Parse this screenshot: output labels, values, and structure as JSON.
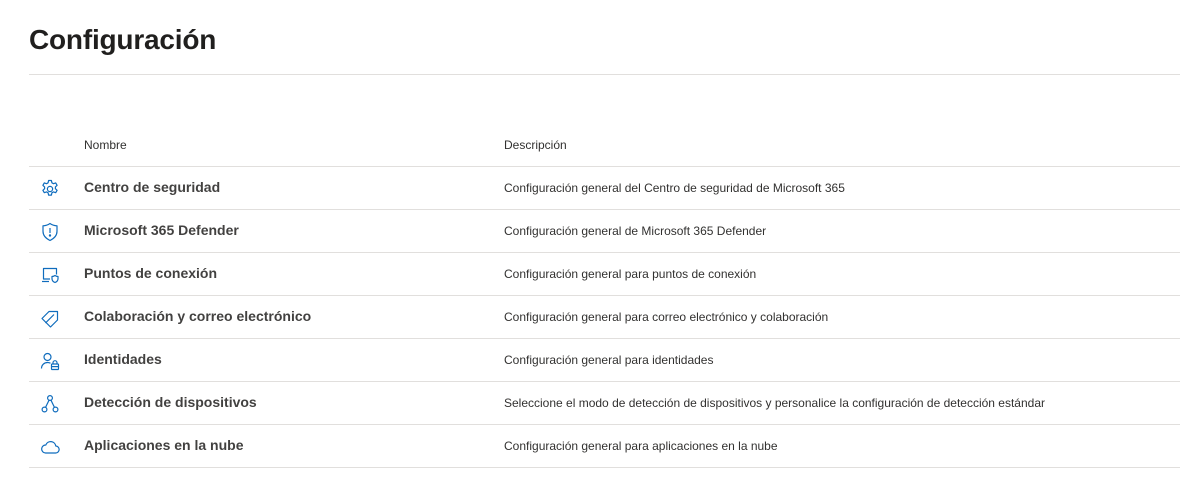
{
  "page": {
    "title": "Configuración"
  },
  "table": {
    "columns": {
      "name": "Nombre",
      "description": "Descripción"
    },
    "rows": [
      {
        "icon": "gear-icon",
        "name": "Centro de seguridad",
        "description": "Configuración general del Centro de seguridad de Microsoft 365"
      },
      {
        "icon": "shield-icon",
        "name": "Microsoft 365 Defender",
        "description": "Configuración general de Microsoft 365 Defender"
      },
      {
        "icon": "endpoint-device-shield-icon",
        "name": "Puntos de conexión",
        "description": "Configuración general para puntos de conexión"
      },
      {
        "icon": "tag-icon",
        "name": "Colaboración y correo electrónico",
        "description": "Configuración general para correo electrónico y colaboración"
      },
      {
        "icon": "person-lock-icon",
        "name": "Identidades",
        "description": "Configuración general para identidades"
      },
      {
        "icon": "device-discovery-nodes-icon",
        "name": "Detección de dispositivos",
        "description": "Seleccione el modo de detección de dispositivos y personalice la configuración de detección estándar"
      },
      {
        "icon": "cloud-icon",
        "name": "Aplicaciones en la nube",
        "description": "Configuración general para aplicaciones en la nube"
      }
    ]
  },
  "colors": {
    "icon": "#0f6cbd",
    "divider": "#e1dfdd",
    "text": "#323130"
  }
}
